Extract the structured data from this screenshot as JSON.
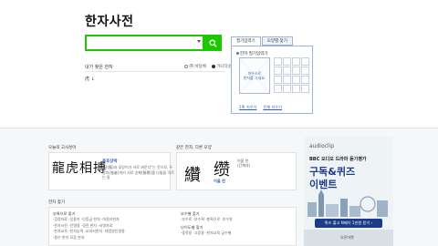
{
  "page": {
    "title": "한자사전"
  },
  "search": {
    "placeholder": "",
    "button_label": "검색"
  },
  "recent": {
    "label": "내가 찾은 한자",
    "options": [
      "㈜ 바탕체",
      "가나다순"
    ],
    "selected_index": 1,
    "history_item": "虎 ↓"
  },
  "hand_input": {
    "tabs": [
      "필기입력기",
      "모양별 찾기"
    ],
    "active_tab": 0,
    "panel_title": "한자 필기입력기",
    "draw_hint": "마우스로\n한자를 그세요.",
    "links": [
      "1획 지우기",
      "전체 지우기"
    ]
  },
  "idiom": {
    "section_label": "오늘의 고사성어",
    "hanja": "龍虎相搏",
    "reading": "용호상박",
    "description": "\"용(龍)과 호랑이가 서로 싸운다\"는 뜻으로, 두 강자(強者)끼리 서로 승패(勝敗)를 다툼을 이르는 말"
  },
  "lookalike": {
    "section_label": "같은 한자, 다른 모양",
    "left_hanja": "纘",
    "right_hanja": "缵",
    "right_meaning": "이을 찬",
    "right_sub": "(간체자)",
    "reading": "이을 찬"
  },
  "find": {
    "section_label": "한자 찾기",
    "groups": [
      {
        "title": "부록으로 찾기",
        "rows": [
          "·검정자료  ·상용자  ·인증급 한자  ·미정리한자",
          "·한자사전  ·인명용  ·경전 한자  ·서명자료",
          "·한자교육 ·한자능력 ·교과서한자 ·대법원인명용",
          "·필수 한자 모음 한자"
        ]
      },
      {
        "title": "부수별 찾기",
        "rows": [
          "·부수로  ·부수획 ·총획수로 ·부수명"
        ]
      },
      {
        "title": "난이도별 찾기",
        "rows": [
          "·중학용  ·고등용  ·한자교육 급수별"
        ]
      }
    ]
  },
  "ad": {
    "brand": "audioclip",
    "line1": "BBC 오디오 드라마 듣기평가",
    "line2": "구독&퀴즈",
    "line3": "이벤트",
    "cta": "퀴즈 풀고 N페이 1만원 받기 ›",
    "sponsor": "오픈마켓"
  },
  "colors": {
    "accent": "#1ec800",
    "link": "#3b64b0",
    "ad_navy": "#1e3b8a"
  }
}
